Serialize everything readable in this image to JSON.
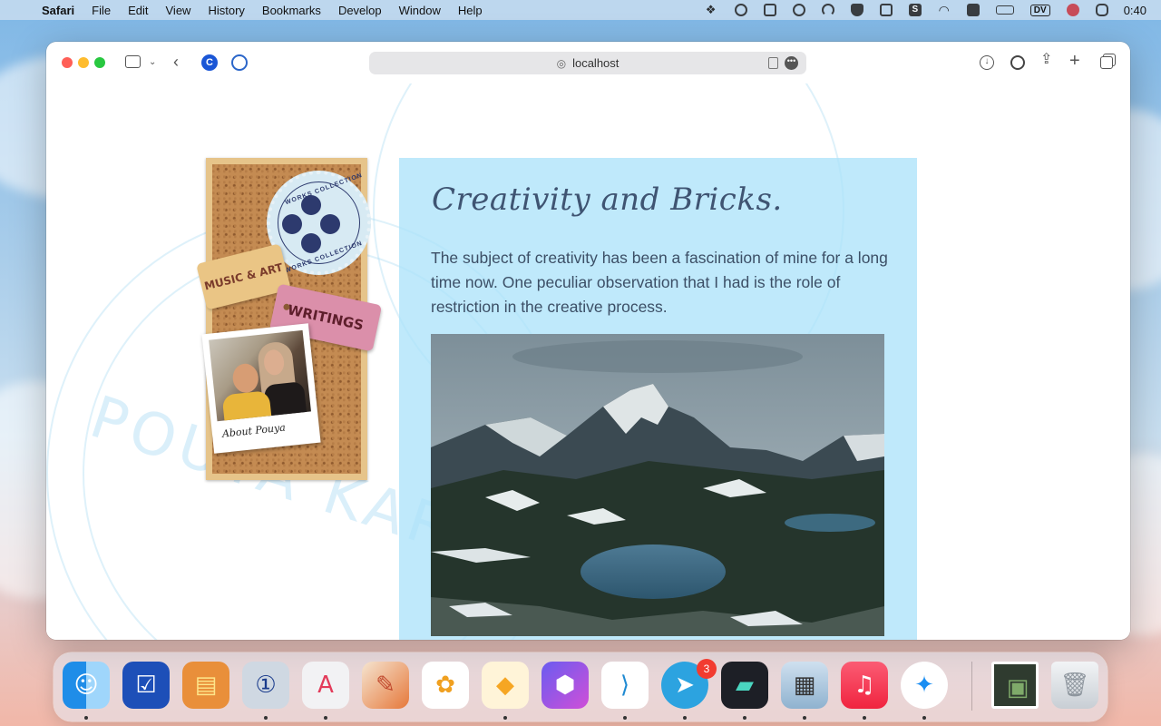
{
  "menubar": {
    "app_name": "Safari",
    "items": [
      "File",
      "Edit",
      "View",
      "History",
      "Bookmarks",
      "Develop",
      "Window",
      "Help"
    ],
    "status": {
      "dv_label": "DV",
      "clock": "0:40",
      "icons": [
        "dropbox-icon",
        "password-lock-icon",
        "clipboard-icon",
        "play-circle-icon",
        "speedometer-icon",
        "shield-icon",
        "bot-icon",
        "s-app-icon",
        "wifi-icon",
        "layout-icon",
        "battery-icon",
        "dv-icon",
        "flower-icon",
        "control-center-icon"
      ]
    }
  },
  "browser": {
    "url": "localhost",
    "toolbar_icons": [
      "sidebar-icon",
      "chevron-down-icon",
      "back-arrow-icon",
      "extension-c-icon",
      "extension-refresh-icon",
      "download-icon",
      "password-icon",
      "share-icon",
      "new-tab-icon",
      "tabs-overview-icon"
    ]
  },
  "page": {
    "board": {
      "seal_text_top": "WORKS COLLECTION",
      "seal_text_bottom": "WORKS COLLECTION",
      "tag_music": "MUSIC & ART",
      "tag_writings": "WRITINGS",
      "polaroid_caption": "About Pouya"
    },
    "article": {
      "title": "Creativity and Bricks.",
      "body": "The subject of creativity has been a fascination of mine for a long time now. One peculiar observation that I had is the role of restriction in the creative process."
    },
    "watermark_text": "POUYA KARY"
  },
  "dock": {
    "apps": [
      "Finder",
      "OmniFocus",
      "Stickies",
      "1Password",
      "Affinity",
      "Pixelmator Pro",
      "Photos",
      "Sketch",
      "Monodraw",
      "Visual Studio Code",
      "Telegram",
      "Linear",
      "Preview",
      "Music",
      "Safari",
      "Downloads",
      "Trash"
    ],
    "telegram_badge": "3"
  }
}
